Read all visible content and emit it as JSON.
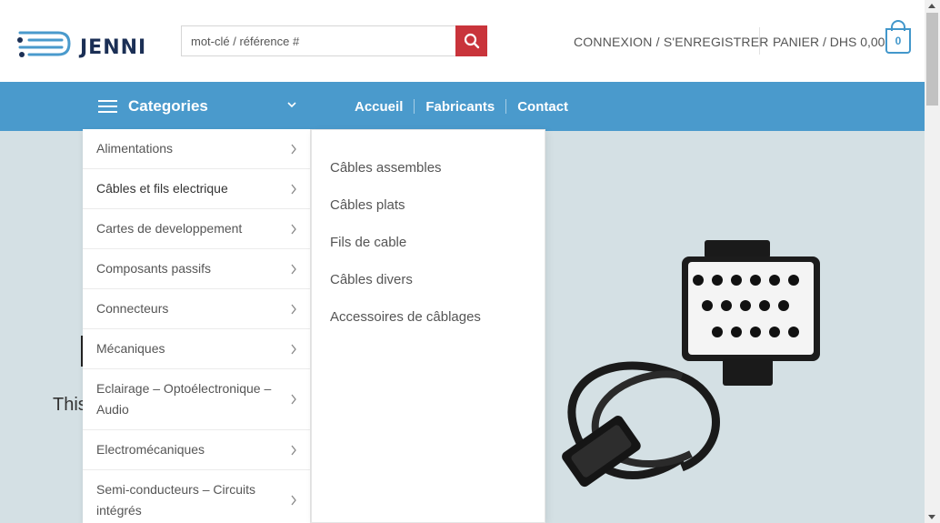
{
  "brand": {
    "name": "JENNI",
    "color": "#1b2f55"
  },
  "search": {
    "placeholder": "mot-clé / référence #",
    "button_icon": "search-icon"
  },
  "account": {
    "label": "CONNEXION / S'ENREGISTRER"
  },
  "cart": {
    "label": "PANIER / DHS 0,00",
    "count": "0",
    "icon": "cart-icon"
  },
  "nav": {
    "categories_label": "Categories",
    "links": [
      "Accueil",
      "Fabricants",
      "Contact"
    ]
  },
  "categories": [
    {
      "label": "Alimentations"
    },
    {
      "label": "Câbles et fils electrique"
    },
    {
      "label": "Cartes de developpement"
    },
    {
      "label": "Composants passifs"
    },
    {
      "label": "Connecteurs"
    },
    {
      "label": "Mécaniques"
    },
    {
      "label": "Eclairage – Optoélectronique – Audio"
    },
    {
      "label": "Electromécaniques"
    },
    {
      "label": "Semi-conducteurs – Circuits intégrés"
    }
  ],
  "submenu": [
    {
      "label": "Câbles assembles"
    },
    {
      "label": "Câbles plats"
    },
    {
      "label": "Fils de cable"
    },
    {
      "label": "Câbles divers"
    },
    {
      "label": "Accessoires de câblages"
    }
  ],
  "hero": {
    "text": "This"
  },
  "colors": {
    "nav_bg": "#4a9acc",
    "search_btn": "#c9343b",
    "hero_bg": "#d4e0e4"
  }
}
